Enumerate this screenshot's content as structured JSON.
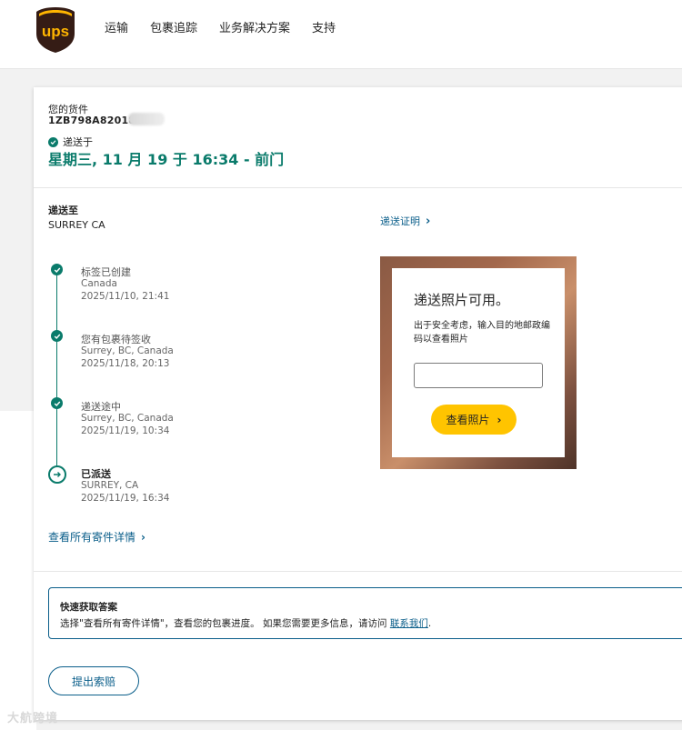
{
  "header": {
    "logo_text": "ups",
    "nav": [
      "运输",
      "包裹追踪",
      "业务解决方案",
      "支持"
    ]
  },
  "shipment": {
    "label": "您的货件",
    "tracking_number": "1ZB798A8201868",
    "status_label": "递送于",
    "delivered_date": "星期三, 11 月 19 于 16:34 - 前门",
    "ship_to_label": "递送至",
    "ship_to_city": "SURREY CA"
  },
  "timeline": [
    {
      "title": "标签已创建",
      "location": "Canada",
      "time": "2025/11/10, 21:41"
    },
    {
      "title": "您有包裹待签收",
      "location": "Surrey, BC, Canada",
      "time": "2025/11/18, 20:13"
    },
    {
      "title": "递送途中",
      "location": "Surrey, BC, Canada",
      "time": "2025/11/19, 10:34"
    },
    {
      "title": "已派送",
      "location": "SURREY, CA",
      "time": "2025/11/19, 16:34"
    }
  ],
  "all_details_link": "查看所有寄件详情",
  "proof": {
    "link": "递送证明",
    "title": "递送照片可用。",
    "desc": "出于安全考虑，输入目的地邮政编码以查看照片",
    "input_value": "",
    "button": "查看照片"
  },
  "quick": {
    "title": "快速获取答案",
    "text": "选择\"查看所有寄件详情\"，查看您的包裹进度。 如果您需要更多信息，请访问 ",
    "link": "联系我们",
    "suffix": "."
  },
  "claim_button": "提出索赔",
  "watermark": "大航跨境",
  "colors": {
    "accent": "#0a7b6b",
    "link": "#0a5e8a",
    "button": "#ffc400",
    "brand_brown": "#351c15"
  }
}
